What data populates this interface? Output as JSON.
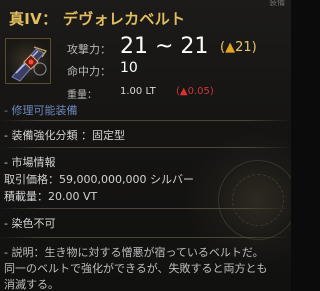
{
  "window": {
    "corner_text": "装備"
  },
  "item": {
    "name": "真IV： デヴォレカベルト",
    "icon_name": "belt-icon"
  },
  "stats": {
    "attack": {
      "label": "攻撃力：",
      "value": "21 ~ 21",
      "bonus_symbol": "▲",
      "bonus_value": "21",
      "bonus_open": "(",
      "bonus_close": ")"
    },
    "accuracy": {
      "label": "命中力：",
      "value": "10"
    },
    "weight": {
      "label": "重量：",
      "value": "1.00 LT",
      "diff_open": "(",
      "diff_symbol": "▲",
      "diff_value": "0.05",
      "diff_close": ")"
    }
  },
  "repair": {
    "text": "- 修理可能装備"
  },
  "enhancement": {
    "text": "- 装備強化分類 ：固定型"
  },
  "market": {
    "header": "- 市場情報",
    "price": "取引価格：59,000,000,000 シルバー",
    "stock": "積載量：20.00 VT"
  },
  "dye": {
    "text": "- 染色不可"
  },
  "description": {
    "line1": "- 説明：生き物に対する憎悪が宿っているベルトだ。",
    "line2": "同一のベルトで強化ができるが、失敗すると両方とも",
    "line3": "消滅する。"
  },
  "colors": {
    "title": "#e3be5e",
    "bonus": "#e8c56a",
    "weight_diff": "#c43a3a",
    "repair": "#6c88ba"
  }
}
